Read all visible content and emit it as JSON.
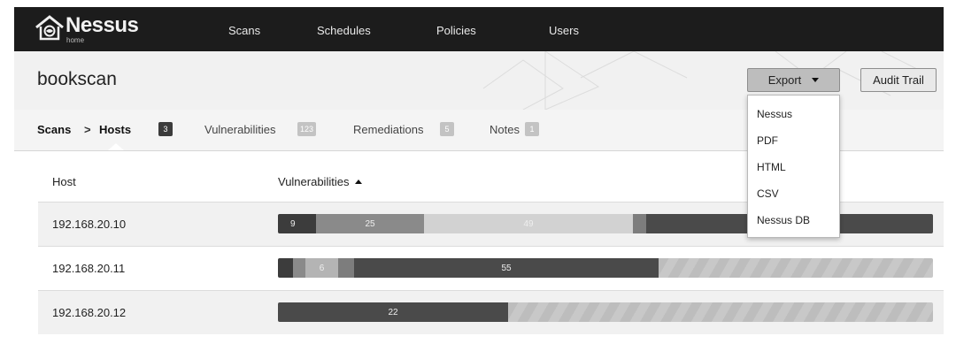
{
  "app": {
    "name": "Nessus",
    "edition": "home"
  },
  "nav": {
    "items": [
      "Scans",
      "Schedules",
      "Policies",
      "Users"
    ]
  },
  "header": {
    "title": "bookscan",
    "export_label": "Export",
    "audit_label": "Audit Trail"
  },
  "breadcrumb": {
    "scans": "Scans",
    "separator": ">",
    "hosts": "Hosts",
    "hosts_count": "3"
  },
  "tabs": [
    {
      "label": "Vulnerabilities",
      "count": "123"
    },
    {
      "label": "Remediations",
      "count": "5"
    },
    {
      "label": "Notes",
      "count": "1"
    }
  ],
  "table": {
    "columns": {
      "host": "Host",
      "vulnerabilities": "Vulnerabilities"
    },
    "rows": [
      {
        "host": "192.168.20.10",
        "labels": [
          "9",
          "25",
          "49"
        ]
      },
      {
        "host": "192.168.20.11",
        "labels": [
          "6",
          "55"
        ]
      },
      {
        "host": "192.168.20.12",
        "labels": [
          "22"
        ]
      }
    ]
  },
  "export_menu": {
    "items": [
      "Nessus",
      "PDF",
      "HTML",
      "CSV",
      "Nessus DB"
    ]
  },
  "colors": {
    "topbar": "#1c1c1c",
    "header_bg": "#f1f1f1",
    "critical": "#3c3c3c",
    "high": "#8a8a8a",
    "medium": "#b4b4b4"
  }
}
